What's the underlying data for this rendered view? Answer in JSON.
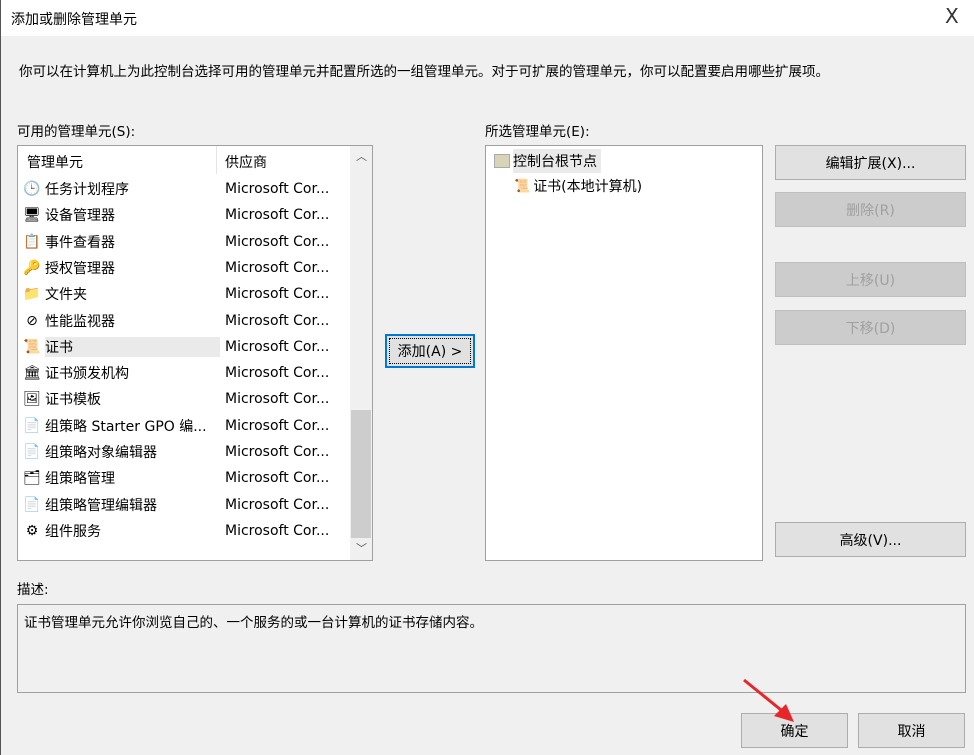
{
  "window": {
    "title": "添加或删除管理单元",
    "close": "X"
  },
  "intro": "你可以在计算机上为此控制台选择可用的管理单元并配置所选的一组管理单元。对于可扩展的管理单元，你可以配置要启用哪些扩展项。",
  "available": {
    "label": "可用的管理单元(S):",
    "col_snapin": "管理单元",
    "col_vendor": "供应商",
    "items": [
      {
        "name": "任务计划程序",
        "vendor": "Microsoft Cor...",
        "icon": "🕒"
      },
      {
        "name": "设备管理器",
        "vendor": "Microsoft Cor...",
        "icon": "🖥"
      },
      {
        "name": "事件查看器",
        "vendor": "Microsoft Cor...",
        "icon": "📋"
      },
      {
        "name": "授权管理器",
        "vendor": "Microsoft Cor...",
        "icon": "🔑"
      },
      {
        "name": "文件夹",
        "vendor": "Microsoft Cor...",
        "icon": "📁"
      },
      {
        "name": "性能监视器",
        "vendor": "Microsoft Cor...",
        "icon": "⊘"
      },
      {
        "name": "证书",
        "vendor": "Microsoft Cor...",
        "icon": "📜"
      },
      {
        "name": "证书颁发机构",
        "vendor": "Microsoft Cor...",
        "icon": "🏛"
      },
      {
        "name": "证书模板",
        "vendor": "Microsoft Cor...",
        "icon": "🖼"
      },
      {
        "name": "组策略 Starter GPO 编...",
        "vendor": "Microsoft Cor...",
        "icon": "📄"
      },
      {
        "name": "组策略对象编辑器",
        "vendor": "Microsoft Cor...",
        "icon": "📄"
      },
      {
        "name": "组策略管理",
        "vendor": "Microsoft Cor...",
        "icon": "🗂"
      },
      {
        "name": "组策略管理编辑器",
        "vendor": "Microsoft Cor...",
        "icon": "📄"
      },
      {
        "name": "组件服务",
        "vendor": "Microsoft Cor...",
        "icon": "⚙"
      }
    ]
  },
  "add_button": "添加(A) >",
  "selected": {
    "label": "所选管理单元(E):",
    "root": "控制台根节点",
    "child": "证书(本地计算机)"
  },
  "buttons": {
    "edit_ext": "编辑扩展(X)...",
    "remove": "删除(R)",
    "move_up": "上移(U)",
    "move_down": "下移(D)",
    "advanced": "高级(V)...",
    "ok": "确定",
    "cancel": "取消"
  },
  "description": {
    "label": "描述:",
    "text": "证书管理单元允许你浏览自己的、一个服务的或一台计算机的证书存储内容。"
  },
  "colors": {
    "annotation_arrow": "#e8262a"
  }
}
